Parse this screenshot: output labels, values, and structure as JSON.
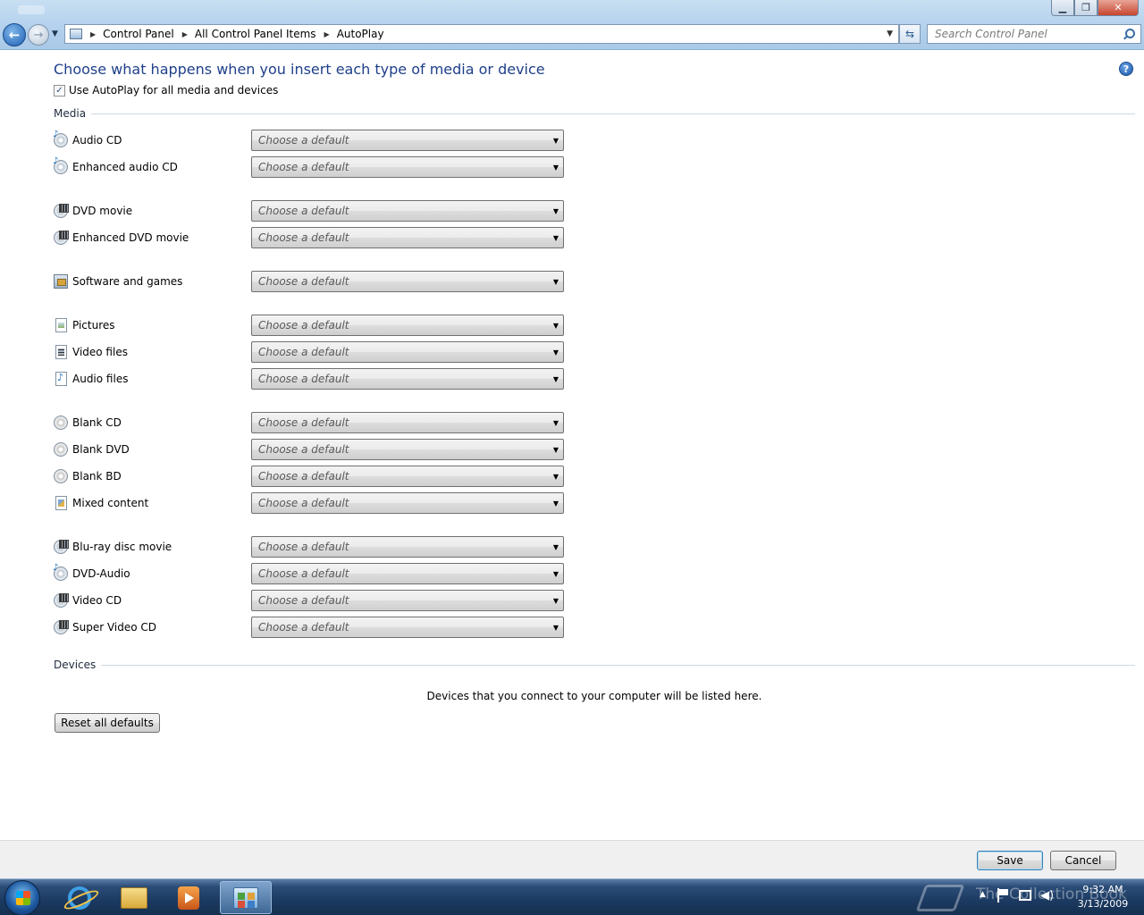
{
  "window": {
    "controls": {
      "minimize": "▁",
      "maximize": "❐",
      "close": "✕"
    }
  },
  "address_bar": {
    "breadcrumbs": [
      "Control Panel",
      "All Control Panel Items",
      "AutoPlay"
    ]
  },
  "search": {
    "placeholder": "Search Control Panel"
  },
  "main": {
    "title": "Choose what happens when you insert each type of media or device",
    "use_autoplay_label": "Use AutoPlay for all media and devices",
    "use_autoplay_checked": true,
    "media_section_label": "Media",
    "devices_section_label": "Devices",
    "devices_message": "Devices that you connect to your computer will be listed here.",
    "reset_button": "Reset all defaults",
    "media_items": [
      {
        "label": "Audio CD",
        "icon": "audio-cd-icon",
        "value": "Choose a default"
      },
      {
        "label": "Enhanced audio CD",
        "icon": "enhanced-audio-cd-icon",
        "value": "Choose a default"
      },
      {
        "label": "DVD movie",
        "icon": "dvd-movie-icon",
        "value": "Choose a default"
      },
      {
        "label": "Enhanced DVD movie",
        "icon": "enhanced-dvd-movie-icon",
        "value": "Choose a default"
      },
      {
        "label": "Software and games",
        "icon": "software-icon",
        "value": "Choose a default"
      },
      {
        "label": "Pictures",
        "icon": "pictures-icon",
        "value": "Choose a default"
      },
      {
        "label": "Video files",
        "icon": "video-files-icon",
        "value": "Choose a default"
      },
      {
        "label": "Audio files",
        "icon": "audio-files-icon",
        "value": "Choose a default"
      },
      {
        "label": "Blank CD",
        "icon": "blank-cd-icon",
        "value": "Choose a default"
      },
      {
        "label": "Blank DVD",
        "icon": "blank-dvd-icon",
        "value": "Choose a default"
      },
      {
        "label": "Blank BD",
        "icon": "blank-bd-icon",
        "value": "Choose a default"
      },
      {
        "label": "Mixed content",
        "icon": "mixed-content-icon",
        "value": "Choose a default"
      },
      {
        "label": "Blu-ray disc movie",
        "icon": "bluray-movie-icon",
        "value": "Choose a default"
      },
      {
        "label": "DVD-Audio",
        "icon": "dvd-audio-icon",
        "value": "Choose a default"
      },
      {
        "label": "Video CD",
        "icon": "video-cd-icon",
        "value": "Choose a default"
      },
      {
        "label": "Super Video CD",
        "icon": "super-video-cd-icon",
        "value": "Choose a default"
      }
    ]
  },
  "footer": {
    "save": "Save",
    "cancel": "Cancel"
  },
  "taskbar": {
    "time": "9:32 AM",
    "date": "3/13/2009",
    "watermark": "The Collection Book"
  }
}
